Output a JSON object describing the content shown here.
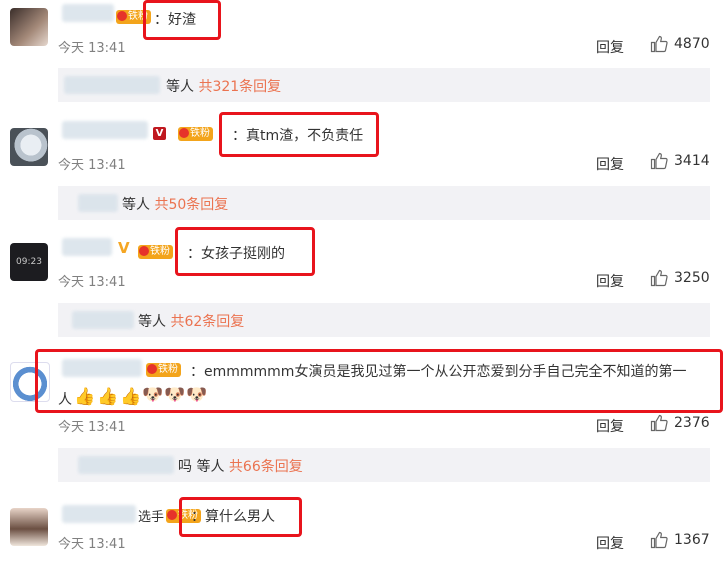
{
  "comments": [
    {
      "text": "：好渣",
      "time": "今天 13:41",
      "reply": "回复",
      "likes": "4870",
      "sub_suffix": "等人",
      "sub_link": "共321条回复"
    },
    {
      "text": "：真tm渣，不负责任",
      "time": "今天 13:41",
      "reply": "回复",
      "likes": "3414",
      "sub_suffix": "等人",
      "sub_link": "共50条回复"
    },
    {
      "text": "：女孩子挺刚的",
      "time": "今天 13:41",
      "reply": "回复",
      "likes": "3250",
      "sub_suffix": "等人",
      "sub_link": "共62条回复"
    },
    {
      "text_line1": "：emmmmmm女演员是我见过第一个从公开恋爱到分手自己完全不知道的第一",
      "text_line2": "人",
      "time": "今天 13:41",
      "reply": "回复",
      "likes": "2376",
      "sub_prefix": "吗",
      "sub_suffix": "等人",
      "sub_link": "共66条回复"
    },
    {
      "name_tail": "选手",
      "text": "：算什么男人",
      "time": "今天 13:41",
      "reply": "回复",
      "likes": "1367"
    }
  ],
  "badges": {
    "fan_label": "铁粉",
    "verified": "V"
  },
  "colors": {
    "link": "#eb7350",
    "highlight": "#e8141c",
    "sub_bg": "#f2f2f5",
    "meta": "#808080"
  },
  "icons": [
    "thumb-up-icon",
    "fan-badge-icon",
    "verified-v-icon",
    "thumbs-up-emoji",
    "doge-emoji"
  ]
}
